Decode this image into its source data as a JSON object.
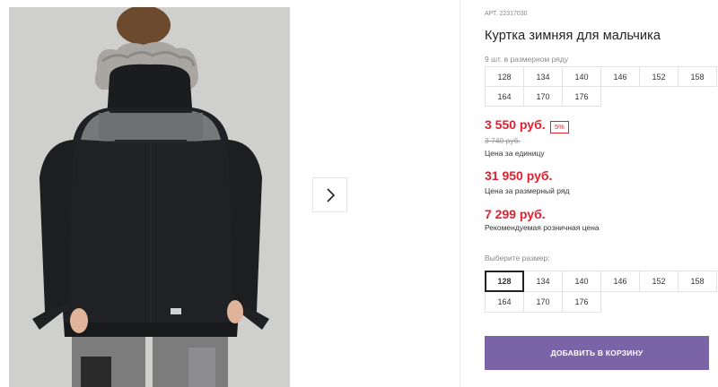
{
  "product": {
    "sku": "АРТ. 22317030",
    "title": "Куртка зимняя для мальчика",
    "sizes_note": "9 шт. в размерном ряду",
    "size_run": [
      "128",
      "134",
      "140",
      "146",
      "152",
      "158",
      "164",
      "170",
      "176"
    ]
  },
  "pricing": {
    "unit_price": "3 550 руб.",
    "discount": "5%",
    "old_price": "3 740 руб.",
    "unit_label": "Цена за единицу",
    "run_price": "31 950 руб.",
    "run_label": "Цена за размерный ряд",
    "retail_price": "7 299 руб.",
    "retail_label": "Рекомендуемая розничная цена"
  },
  "size_selector": {
    "label": "Выберите размер:",
    "options": [
      "128",
      "134",
      "140",
      "146",
      "152",
      "158",
      "164",
      "170",
      "176"
    ],
    "selected": "128"
  },
  "cart": {
    "add_label": "ДОБАВИТЬ В КОРЗИНУ"
  },
  "gallery": {
    "next_icon": "chevron-right-icon"
  },
  "colors": {
    "price_red": "#e0202e",
    "button_purple": "#7a63a6"
  }
}
